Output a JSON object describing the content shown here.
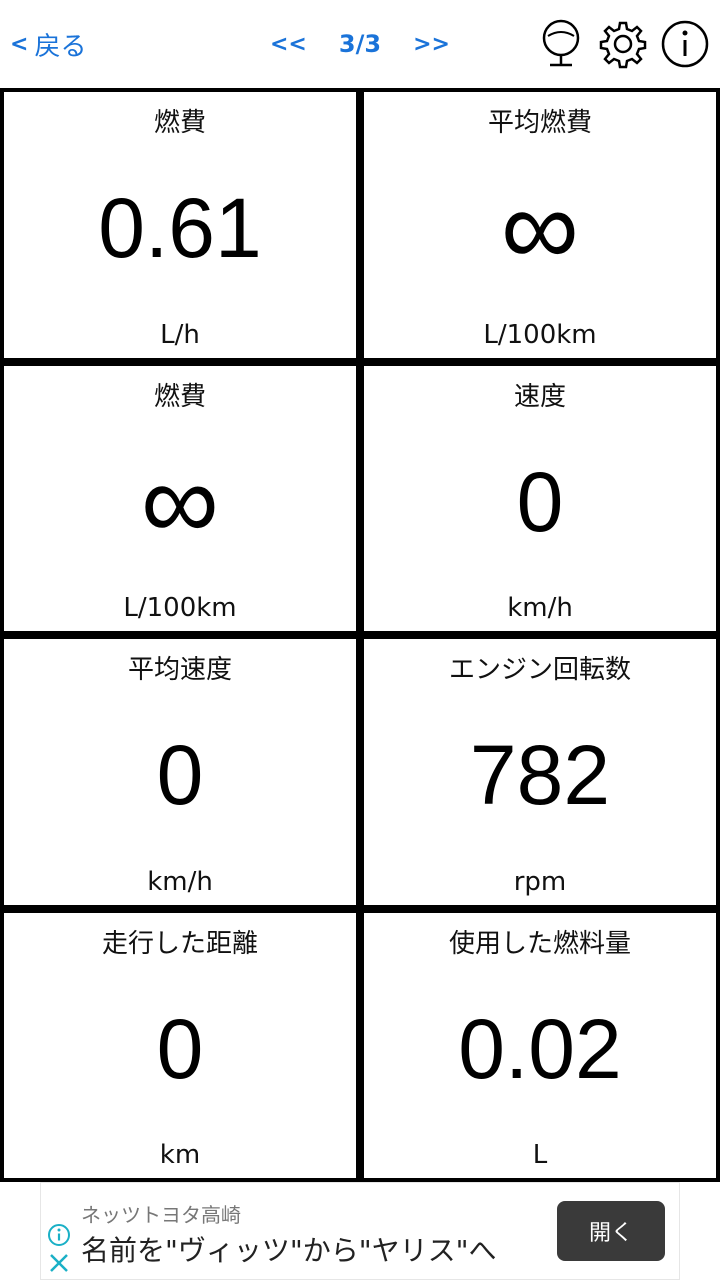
{
  "header": {
    "back_chevron": "<",
    "back_label": "戻る",
    "prev_label": "<<",
    "page_indicator": "3/3",
    "next_label": ">>",
    "icons": [
      "microphone-icon",
      "gear-icon",
      "info-icon"
    ]
  },
  "cells": [
    {
      "label": "燃費",
      "value": "0.61",
      "unit": "L/h"
    },
    {
      "label": "平均燃費",
      "value": "∞",
      "unit": "L/100km"
    },
    {
      "label": "燃費",
      "value": "∞",
      "unit": "L/100km"
    },
    {
      "label": "速度",
      "value": "0",
      "unit": "km/h"
    },
    {
      "label": "平均速度",
      "value": "0",
      "unit": "km/h"
    },
    {
      "label": "エンジン回転数",
      "value": "782",
      "unit": "rpm"
    },
    {
      "label": "走行した距離",
      "value": "0",
      "unit": "km"
    },
    {
      "label": "使用した燃料量",
      "value": "0.02",
      "unit": "L"
    }
  ],
  "ad": {
    "sponsor": "ネッツトヨタ高崎",
    "headline": "名前を\"ヴィッツ\"から\"ヤリス\"へ",
    "open_label": "開く",
    "accent": "#1ab0c6"
  },
  "colors": {
    "accent": "#1a73d9",
    "grid_line": "#000000"
  }
}
